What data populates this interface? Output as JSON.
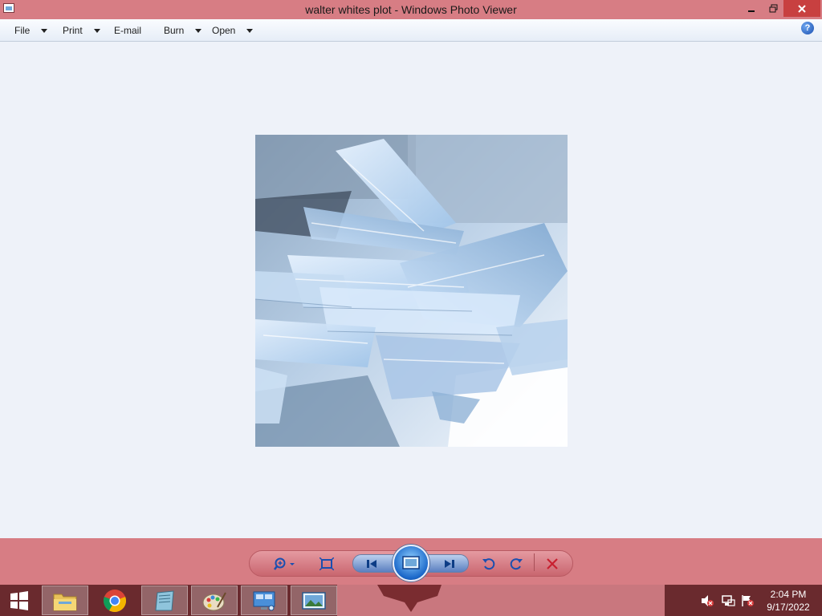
{
  "window": {
    "title": "walter whites plot - Windows Photo Viewer"
  },
  "menu": {
    "items": [
      {
        "label": "File",
        "has_dropdown": true
      },
      {
        "label": "Print",
        "has_dropdown": true
      },
      {
        "label": "E-mail",
        "has_dropdown": false
      },
      {
        "label": "Burn",
        "has_dropdown": true
      },
      {
        "label": "Open",
        "has_dropdown": true
      }
    ],
    "help_icon": "help-icon"
  },
  "photo": {
    "subject": "blue crystal shards"
  },
  "controls": {
    "zoom_icon": "zoom-icon",
    "actual_size_icon": "fit-to-window-icon",
    "previous_icon": "previous-icon",
    "slideshow_icon": "slideshow-icon",
    "next_icon": "next-icon",
    "rotate_ccw_icon": "rotate-counterclockwise-icon",
    "rotate_cw_icon": "rotate-clockwise-icon",
    "delete_icon": "delete-icon"
  },
  "taskbar": {
    "apps": [
      "start-icon",
      "file-explorer-icon",
      "chrome-icon",
      "notepad-icon",
      "paint-icon",
      "remote-desktop-icon",
      "photo-viewer-icon"
    ],
    "clock": {
      "time": "2:04 PM",
      "date": "9/17/2022"
    }
  },
  "colors": {
    "accent": "#d77d84",
    "taskbar": "#6a2a2e",
    "viewer_bg": "#eef2f9",
    "close_button": "#c84040"
  }
}
